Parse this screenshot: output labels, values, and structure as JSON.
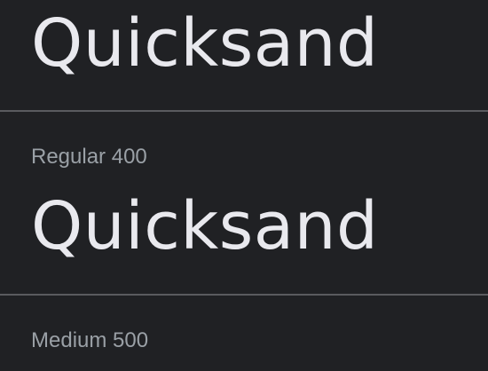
{
  "specimens": [
    {
      "sample_text": "Quicksand"
    },
    {
      "weight_label": "Regular 400",
      "sample_text": "Quicksand"
    },
    {
      "weight_label": "Medium 500"
    }
  ],
  "colors": {
    "background": "#202124",
    "sample_text": "#e9e9ee",
    "label_text": "#9aa0a6",
    "divider": "#5a5b5f"
  }
}
